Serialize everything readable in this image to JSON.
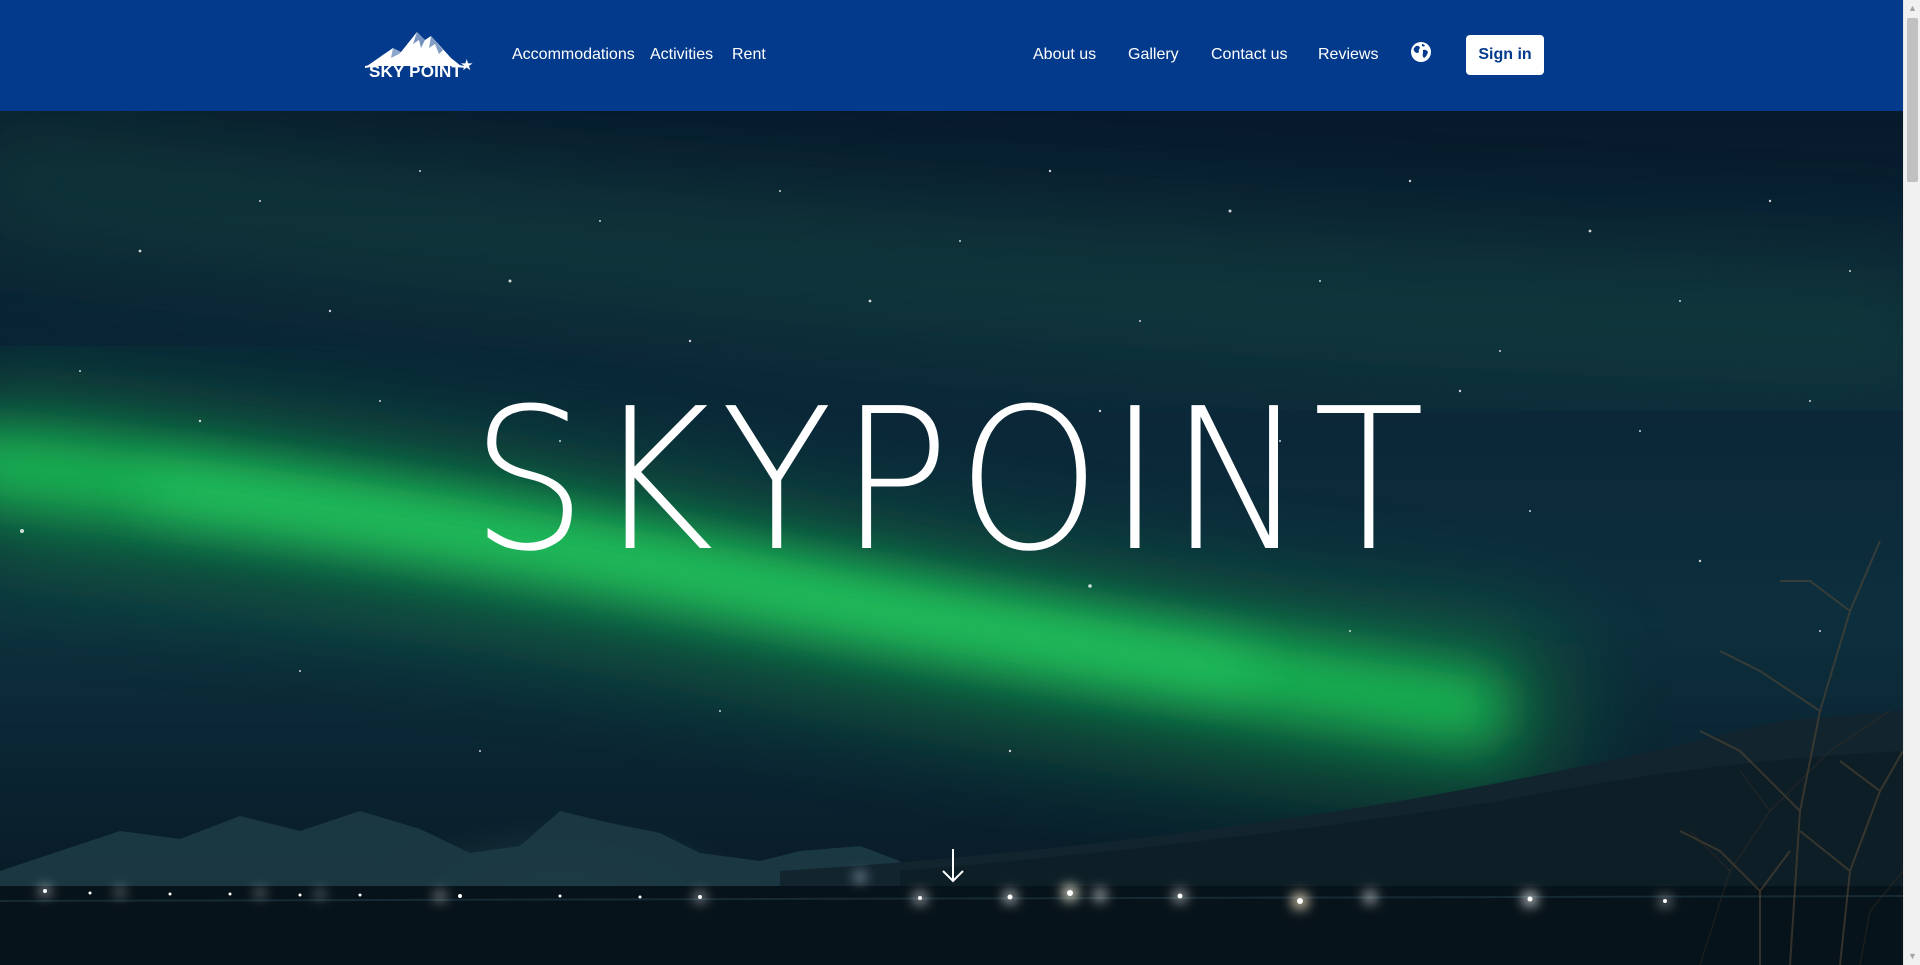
{
  "header": {
    "logo_text": "SKY POINT",
    "logo_star": "★",
    "nav_left": [
      "Accommodations",
      "Activities",
      "Rent"
    ],
    "nav_right": [
      "About us",
      "Gallery",
      "Contact us",
      "Reviews"
    ],
    "globe_icon": "globe-icon",
    "signin_label": "Sign in",
    "background_color": "#033a8c"
  },
  "hero": {
    "title": "SKYPOINT",
    "scroll_icon": "arrow-down-icon"
  },
  "scrollbar": {
    "up_glyph": "▲",
    "down_glyph": "▼"
  }
}
